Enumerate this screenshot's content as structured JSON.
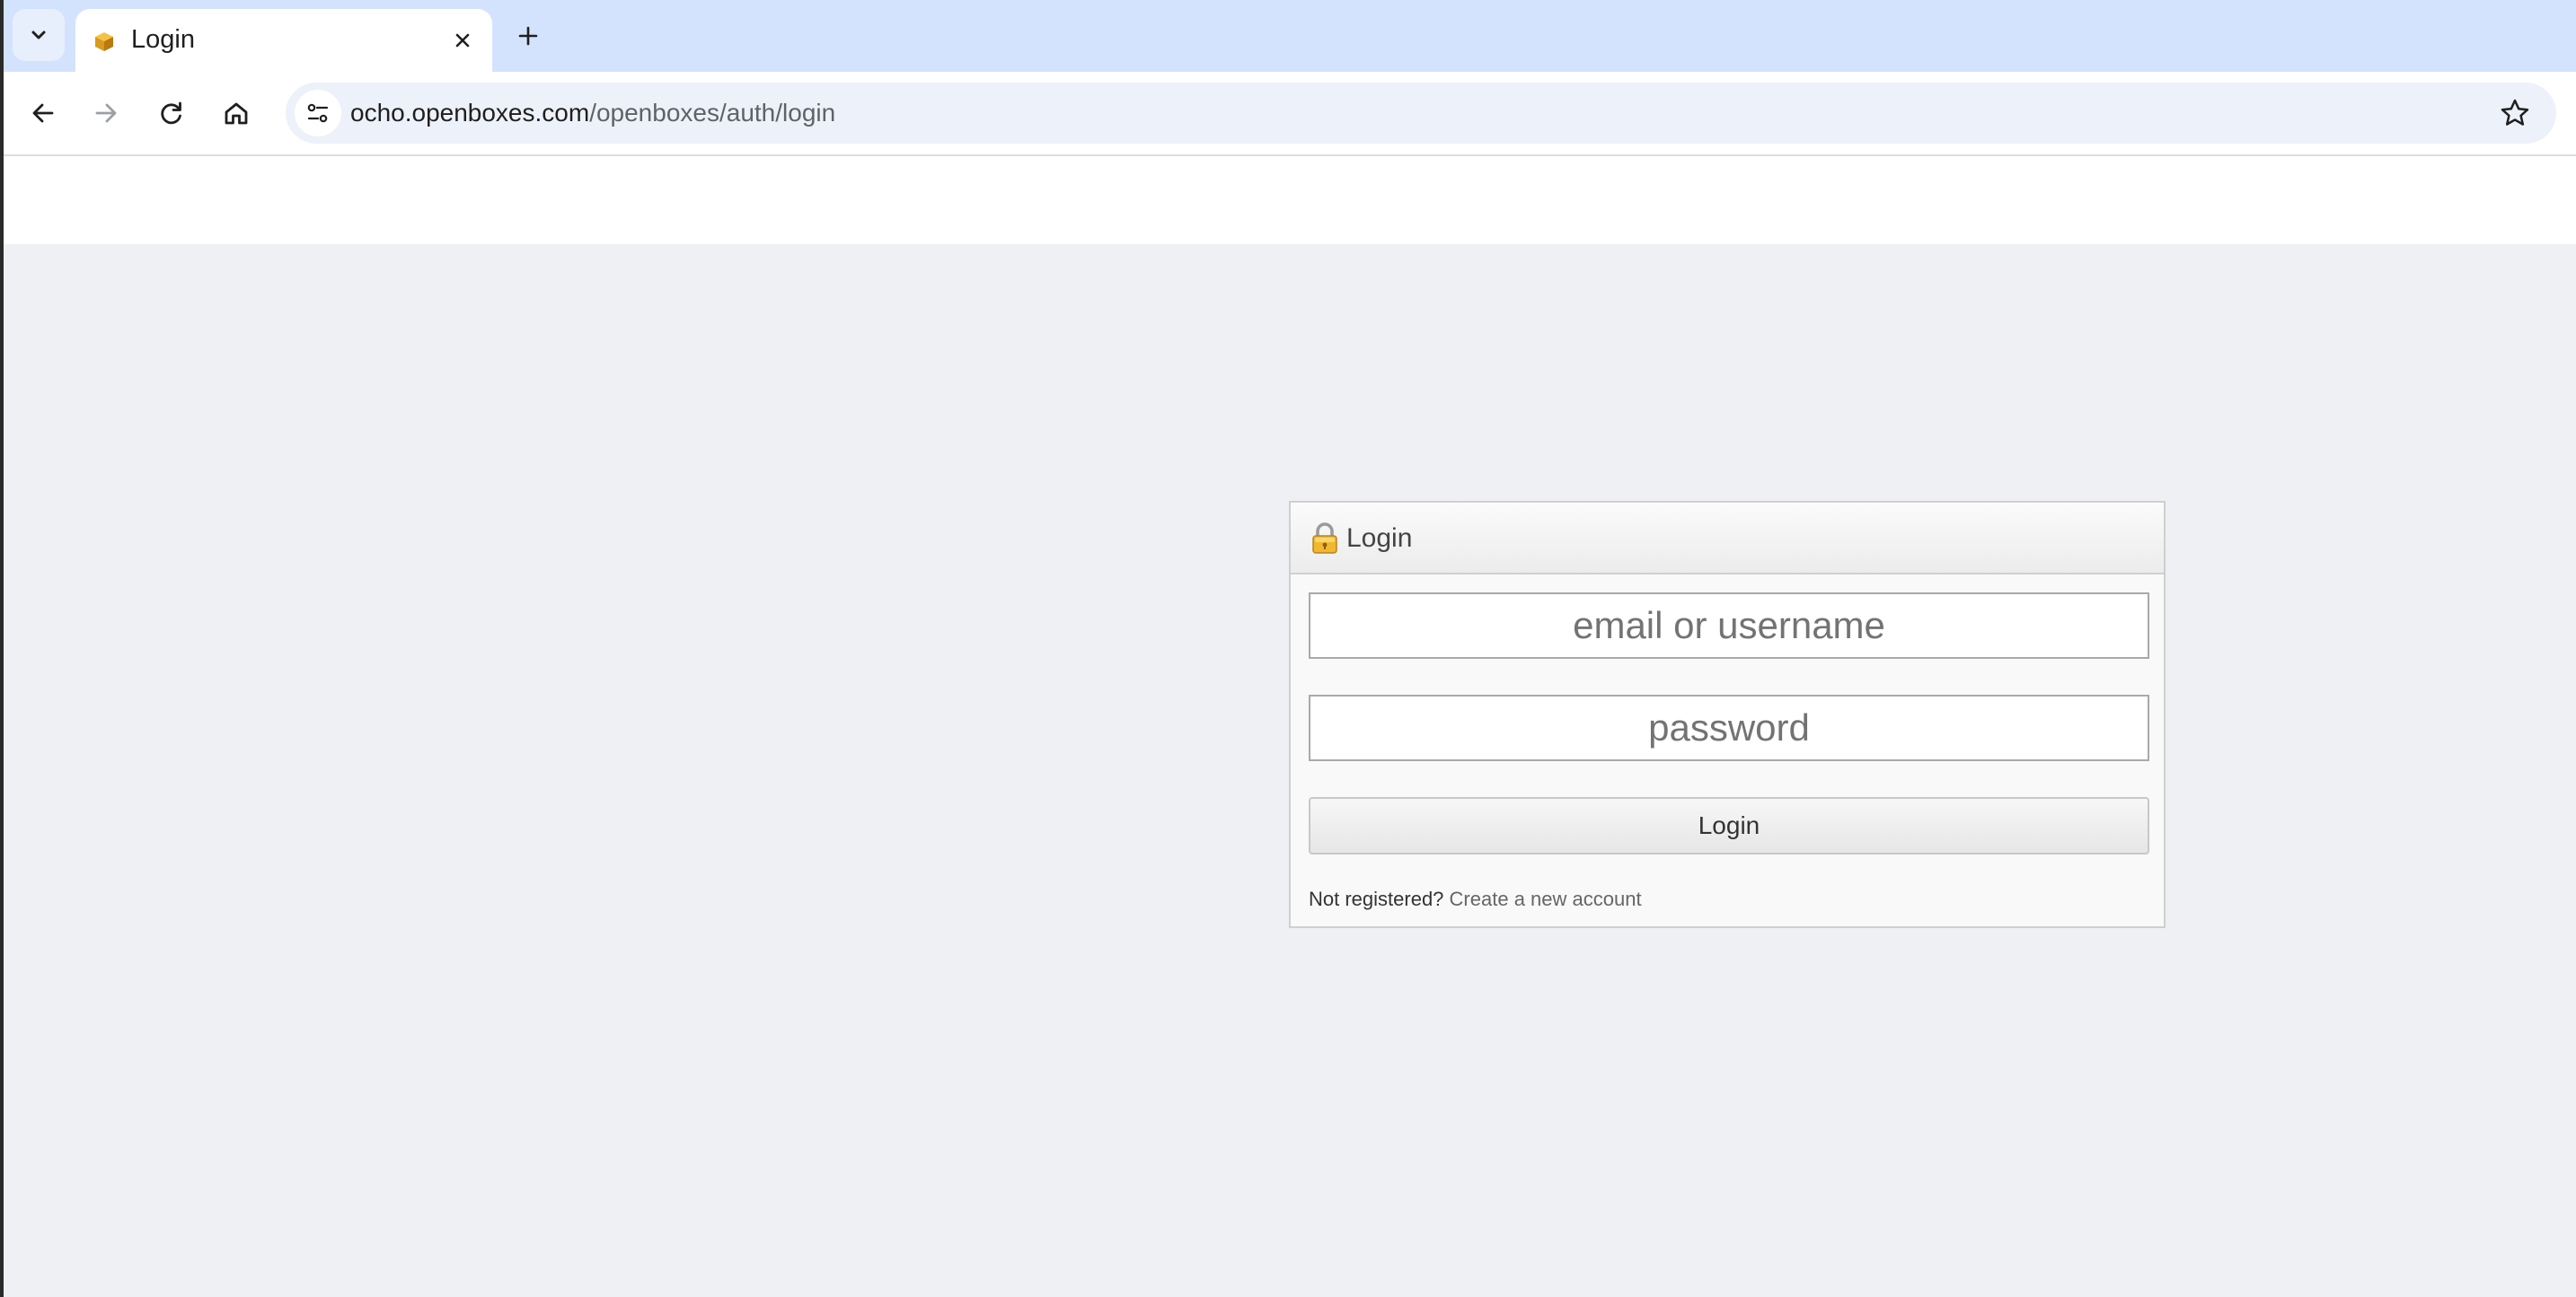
{
  "browser": {
    "tab": {
      "title": "Login",
      "favicon": "openboxes-box-icon"
    },
    "address_bar": {
      "domain": "ocho.openboxes.com",
      "path": "/openboxes/auth/login"
    }
  },
  "login": {
    "heading": "Login",
    "username_placeholder": "email or username",
    "password_placeholder": "password",
    "submit_label": "Login",
    "register_prompt": "Not registered?",
    "register_link": "Create a new account"
  },
  "colors": {
    "tab_strip": "#d3e3fd",
    "page_background": "#eff0f4",
    "login_panel": "#f9f9f9"
  }
}
